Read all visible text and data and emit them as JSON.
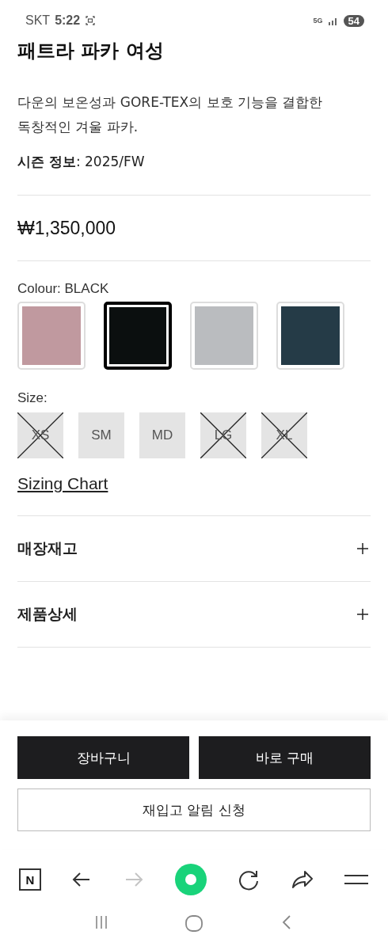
{
  "status_bar": {
    "carrier": "SKT",
    "time": "5:22",
    "network": "5G",
    "battery": "54"
  },
  "product": {
    "title": "패트라 파카 여성",
    "description": "다운의 보온성과 GORE-TEX의 보호 기능을 결합한 독창적인 겨울 파카.",
    "season": "**시즌 정보**: 2025/FW",
    "price": "₩1,350,000"
  },
  "colour": {
    "label": "Colour: BLACK",
    "swatches": [
      {
        "color": "#c0999f",
        "selected": false
      },
      {
        "color": "#0b0f0f",
        "selected": true
      },
      {
        "color": "#babcbf",
        "selected": false
      },
      {
        "color": "#253b47",
        "selected": false
      }
    ]
  },
  "size": {
    "label": "Size:",
    "options": [
      {
        "label": "XS",
        "available": false
      },
      {
        "label": "SM",
        "available": true
      },
      {
        "label": "MD",
        "available": true
      },
      {
        "label": "LG",
        "available": false
      },
      {
        "label": "XL",
        "available": false
      }
    ]
  },
  "sizing_chart": "Sizing Chart",
  "sections": [
    {
      "label": "매장재고",
      "expanded": false
    },
    {
      "label": "제품상세",
      "expanded": false
    }
  ],
  "actions": {
    "cart": "장바구니",
    "buy": "바로 구매",
    "restock": "재입고 알림 신청"
  },
  "browser_bar": {
    "logo": "N",
    "forward_disabled": true
  }
}
